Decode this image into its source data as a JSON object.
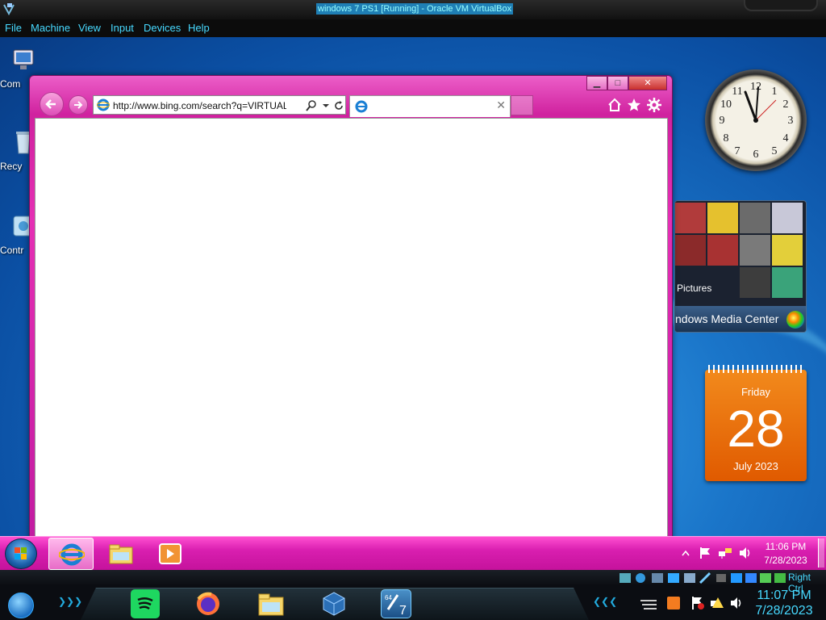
{
  "host": {
    "window_title": "windows 7 PS1 [Running] - Oracle VM VirtualBox",
    "menu": [
      "File",
      "Machine",
      "View",
      "Input",
      "Devices",
      "Help"
    ],
    "host_key_label": "Right Ctrl",
    "time": "11:07 PM",
    "date": "7/28/2023"
  },
  "desktop": {
    "icons": [
      {
        "label": "Com",
        "icon": "computer-icon"
      },
      {
        "label": "Recy",
        "icon": "recycle-bin-icon"
      },
      {
        "label": "Contr",
        "icon": "control-panel-icon"
      }
    ]
  },
  "browser": {
    "address": "http://www.bing.com/search?q=VIRTUALBC",
    "tab_title": "",
    "window_buttons": [
      "minimize",
      "maximize",
      "close"
    ],
    "toolbar_icons": [
      "home-icon",
      "favorites-star-icon",
      "gear-icon"
    ]
  },
  "gadgets": {
    "clock_numerals": [
      "12",
      "1",
      "2",
      "3",
      "4",
      "5",
      "6",
      "7",
      "8",
      "9",
      "10",
      "11"
    ],
    "media_center": {
      "pictures_label": "Pictures",
      "brand_label": "ndows Media Center"
    },
    "calendar": {
      "day_of_week": "Friday",
      "day": "28",
      "month_year": "July 2023"
    }
  },
  "taskbar": {
    "time": "11:06 PM",
    "date": "7/28/2023",
    "pinned": [
      "internet-explorer-icon",
      "file-explorer-icon",
      "media-player-icon"
    ]
  },
  "colors": {
    "accent_pink": "#e52fb4",
    "host_text_cyan": "#47d9ff"
  }
}
